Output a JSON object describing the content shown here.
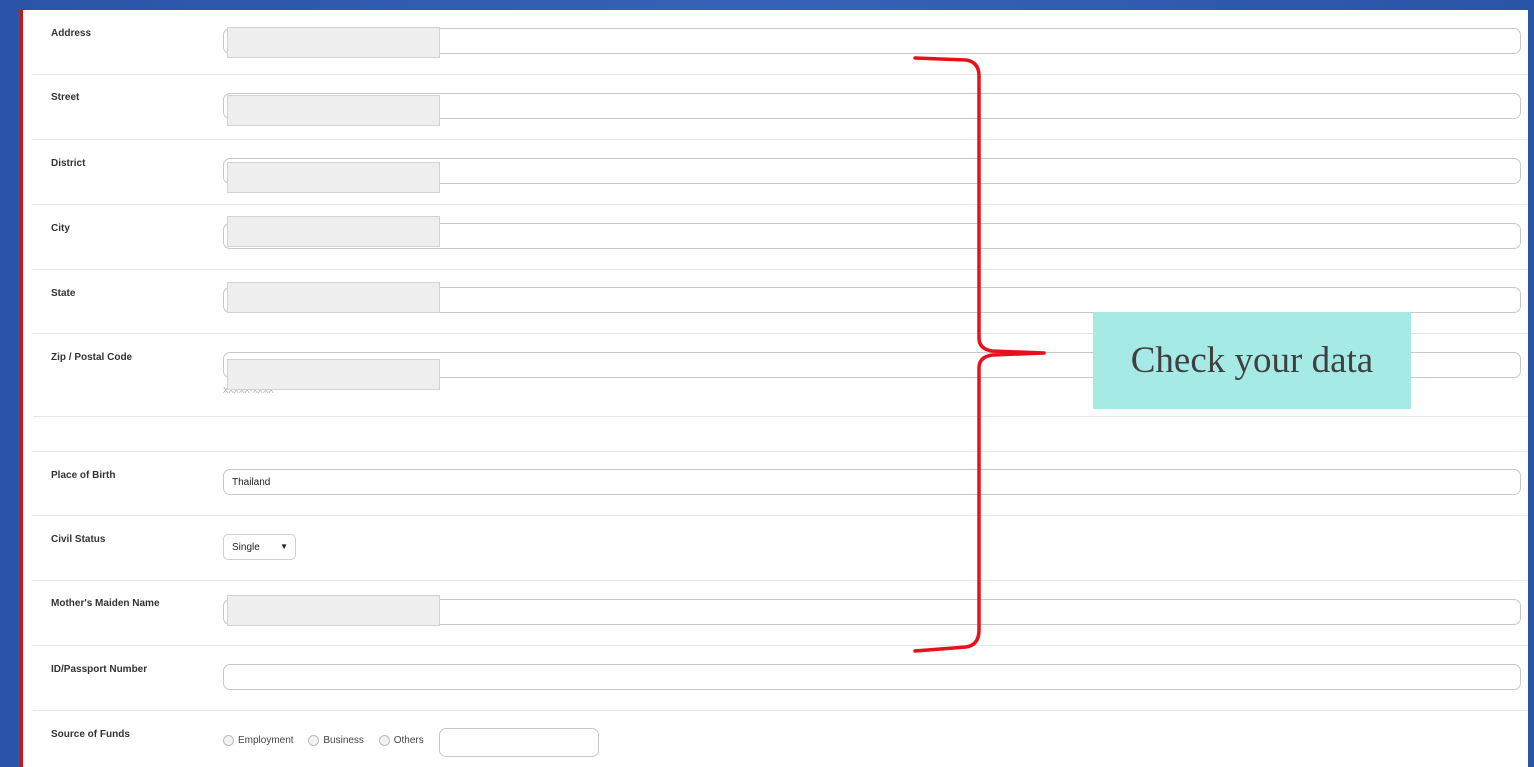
{
  "form": {
    "rows": {
      "address": {
        "label": "Address"
      },
      "street": {
        "label": "Street"
      },
      "district": {
        "label": "District"
      },
      "city": {
        "label": "City"
      },
      "state": {
        "label": "State"
      },
      "zip": {
        "label": "Zip / Postal Code",
        "hint": "XXXXX-XXXX"
      },
      "place_of_birth": {
        "label": "Place of Birth",
        "value": "Thailand"
      },
      "civil_status": {
        "label": "Civil Status",
        "value": "Single"
      },
      "mothers_maiden_name": {
        "label": "Mother's Maiden Name"
      },
      "id_passport": {
        "label": "ID/Passport Number"
      },
      "source_of_funds": {
        "label": "Source of Funds",
        "options": [
          "Employment",
          "Business",
          "Others"
        ]
      }
    }
  },
  "annotation": {
    "callout_text": "Check your data",
    "brace_color": "#e8101a",
    "callout_bg": "#a6eae6"
  },
  "icons": {
    "select_arrow": "▼"
  }
}
